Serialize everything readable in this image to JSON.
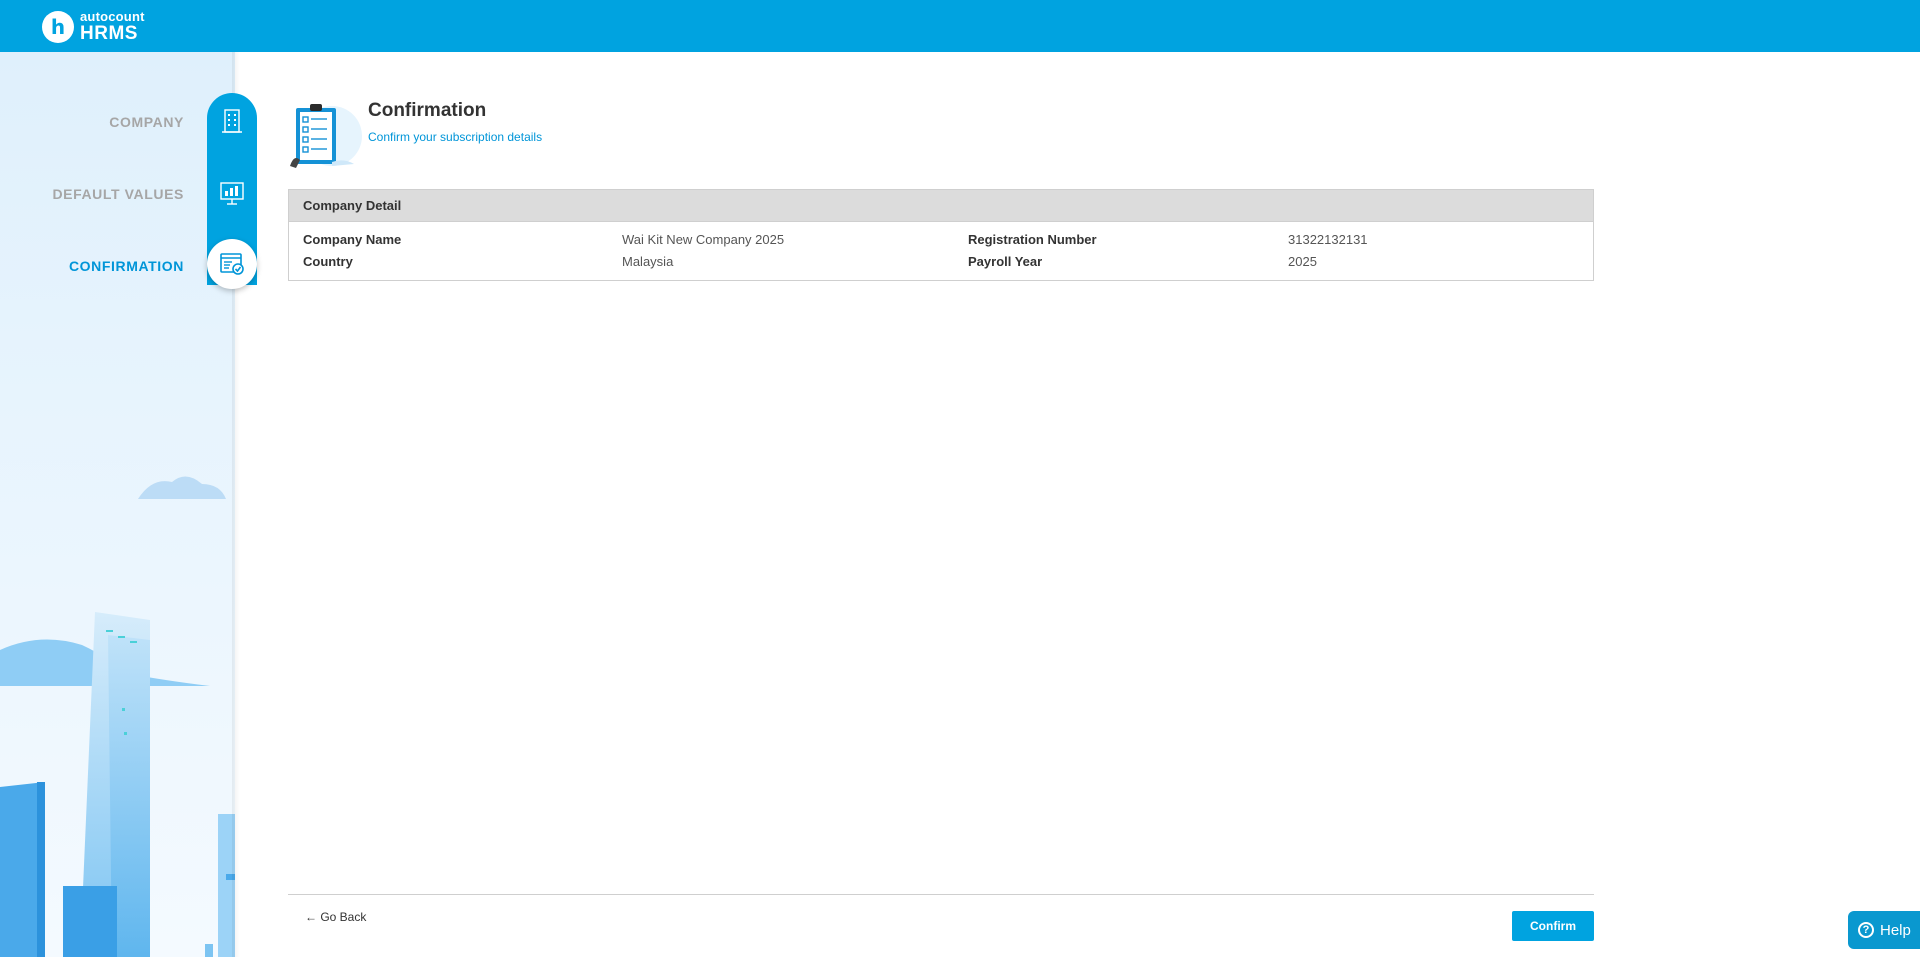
{
  "app": {
    "logo_badge": "h",
    "logo_sub": "autocount",
    "logo_main": "HRMS",
    "brand_color": "#00a3e0"
  },
  "steps": [
    {
      "label": "COMPANY",
      "icon": "building-icon",
      "state": "done"
    },
    {
      "label": "DEFAULT VALUES",
      "icon": "chart-board-icon",
      "state": "done"
    },
    {
      "label": "CONFIRMATION",
      "icon": "confirmation-form-icon",
      "state": "active"
    }
  ],
  "header": {
    "title": "Confirmation",
    "subtitle": "Confirm your subscription details",
    "illustration": "clipboard-checklist-icon"
  },
  "company_detail": {
    "heading": "Company Detail",
    "company_name_label": "Company Name",
    "company_name_value": "Wai Kit New Company 2025",
    "registration_label": "Registration Number",
    "registration_value": "31322132131",
    "country_label": "Country",
    "country_value": "Malaysia",
    "payroll_year_label": "Payroll Year",
    "payroll_year_value": "2025"
  },
  "footer": {
    "go_back_label": "← Go Back",
    "confirm_label": "Confirm",
    "help_label": "Help",
    "help_icon": "question-icon"
  }
}
